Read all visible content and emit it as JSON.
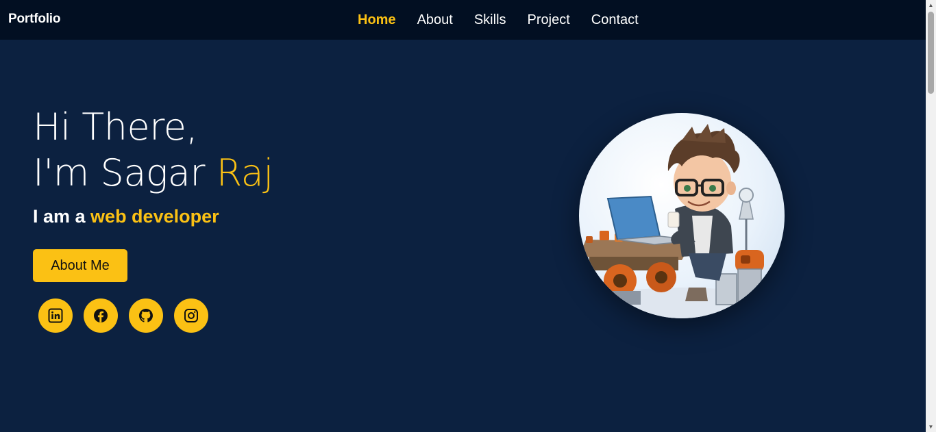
{
  "brand": "Portfolio",
  "nav": [
    {
      "label": "Home",
      "active": true
    },
    {
      "label": "About",
      "active": false
    },
    {
      "label": "Skills",
      "active": false
    },
    {
      "label": "Project",
      "active": false
    },
    {
      "label": "Contact",
      "active": false
    }
  ],
  "hero": {
    "greeting": "Hi There,",
    "intro_prefix": "I'm Sagar ",
    "intro_accent": "Raj",
    "role_prefix": "I am a ",
    "role_accent": "web developer",
    "button_label": "About Me"
  },
  "socials": [
    {
      "icon": "linkedin-icon"
    },
    {
      "icon": "facebook-icon"
    },
    {
      "icon": "github-icon"
    },
    {
      "icon": "instagram-icon"
    }
  ],
  "colors": {
    "background": "#0c2140",
    "navbar": "#020f22",
    "accent": "#fbc114",
    "text": "#ffffff"
  }
}
